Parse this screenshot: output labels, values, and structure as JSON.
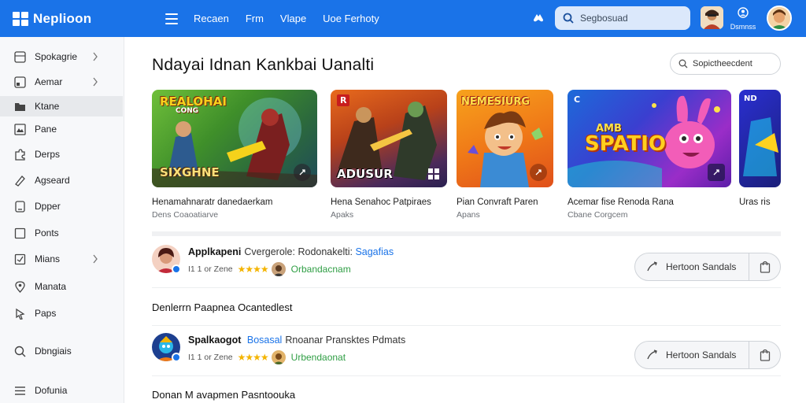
{
  "topbar": {
    "logo_text": "Neplioon",
    "nav": [
      "Recaen",
      "Frm",
      "Vlape",
      "Uoe Ferhoty"
    ],
    "search_placeholder": "Segbosuad",
    "account_label": "Dsmnss"
  },
  "sidebar": {
    "items": [
      {
        "label": "Spokagrie",
        "icon": "grid-icon",
        "chevron": true
      },
      {
        "label": "Aemar",
        "icon": "window-icon",
        "chevron": true
      },
      {
        "label": "Ktane",
        "icon": "folder-icon",
        "chevron": false,
        "active": true
      },
      {
        "label": "Pane",
        "icon": "image-icon",
        "chevron": false
      },
      {
        "label": "Derps",
        "icon": "puzzle-icon",
        "chevron": false
      },
      {
        "label": "Agseard",
        "icon": "tag-icon",
        "chevron": false
      },
      {
        "label": "Dpper",
        "icon": "tablet-icon",
        "chevron": false
      },
      {
        "label": "Ponts",
        "icon": "square-icon",
        "chevron": false
      },
      {
        "label": "Mians",
        "icon": "checkbox-icon",
        "chevron": true
      },
      {
        "label": "Manata",
        "icon": "location-icon",
        "chevron": false
      },
      {
        "label": "Paps",
        "icon": "pointer-icon",
        "chevron": false
      },
      {
        "label": "Dbngiais",
        "icon": "search-icon",
        "chevron": false
      },
      {
        "label": "Dofunia",
        "icon": "menu-icon",
        "chevron": false
      }
    ]
  },
  "main": {
    "title": "Ndayai Idnan Kankbai Uanalti",
    "search_label": "Sopictheecdent",
    "cards": [
      {
        "title": "Henamahnaratr danedaerkam",
        "subtitle": "Dens Coaoatiarve",
        "img_word": "SIXGHNE",
        "img_top_word": "REALOHAI",
        "img_top_word2": "CONG"
      },
      {
        "title": "Hena Senahoc Patpiraes",
        "subtitle": "Apaks",
        "img_word": "ADUSUR",
        "img_top_word": "R"
      },
      {
        "title": "Pian Convraft Paren",
        "subtitle": "Apans",
        "img_top_word": "NEMESIURG"
      },
      {
        "title": "Acemar fise Renoda Rana",
        "subtitle": "Cbane Corgcem",
        "img_word": "SPATIO",
        "img_small_word": "AMB",
        "img_top_word": "C"
      },
      {
        "title": "Uras ris",
        "subtitle": "",
        "img_top_word": "ND"
      }
    ],
    "apps": [
      {
        "name": "Applkapeni",
        "desc": "Cvergerole: Rodonakelti:",
        "link": "Sagafias",
        "meta": "I1 1 or Zene",
        "stars": "★★★★",
        "developer": "Orbandacnam",
        "button": "Hertoon Sandals"
      },
      {
        "name": "Spalkaogot",
        "desc": "Rnoanar Pransktes Pdmats",
        "link": "Bosasal",
        "meta": "I1 1 or Zene",
        "stars": "★★★★",
        "developer": "Urbendaonat",
        "button": "Hertoon Sandals"
      }
    ],
    "sections": [
      "Denlerrn Paapnea Ocantedlest",
      "Donan M avapmen Pasntoouka"
    ]
  },
  "colors": {
    "accent": "#1a73e8",
    "developer_green": "#2f9e44",
    "star": "#f4b400"
  }
}
